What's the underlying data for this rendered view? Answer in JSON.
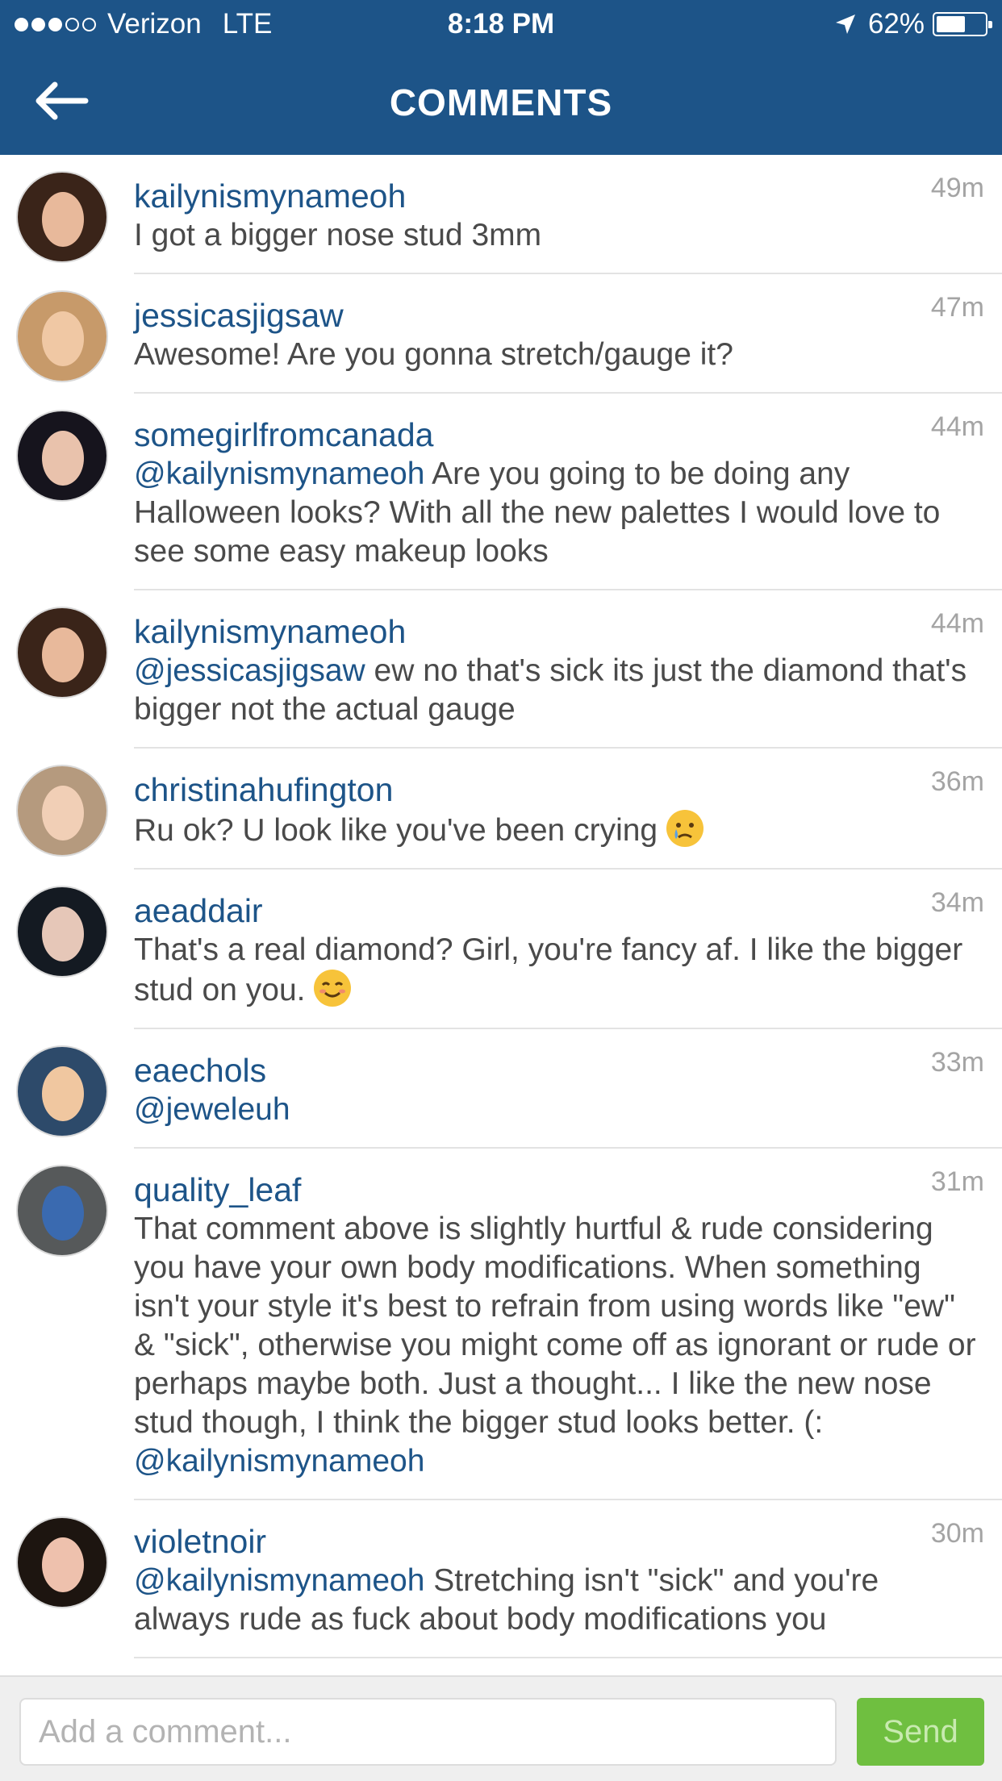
{
  "status_bar": {
    "carrier": "Verizon",
    "network": "LTE",
    "time": "8:18 PM",
    "battery_percent": "62%",
    "battery_level": 0.62,
    "signal_bars_filled": 3,
    "signal_bars_total": 5
  },
  "nav": {
    "title": "COMMENTS",
    "back_icon": "arrow-left-icon"
  },
  "colors": {
    "brand": "#1d5488",
    "username": "#1d5488",
    "text": "#4a4a4a",
    "timestamp": "#a4a4a4",
    "send_button": "#6fbf40"
  },
  "comments": [
    {
      "user": "kailynismyname",
      "user_suffix": "oh",
      "parts": [
        {
          "type": "text",
          "value": "I got a bigger nose stud 3mm"
        }
      ],
      "time": "49m"
    },
    {
      "user": "jessicasjigsaw",
      "parts": [
        {
          "type": "text",
          "value": "Awesome! Are you gonna stretch/gauge it?"
        }
      ],
      "time": "47m"
    },
    {
      "user": "somegirlfromcanada",
      "parts": [
        {
          "type": "mention",
          "value": "@kailynismynameoh"
        },
        {
          "type": "text",
          "value": " Are you going to be doing any Halloween looks? With all the new palettes I would love to see some easy makeup looks"
        }
      ],
      "time": "44m"
    },
    {
      "user": "kailynismynameoh",
      "parts": [
        {
          "type": "mention",
          "value": "@jessicasjigsaw"
        },
        {
          "type": "text",
          "value": " ew no that's sick its just the diamond that's bigger not the actual gauge"
        }
      ],
      "time": "44m"
    },
    {
      "user": "christinahufington",
      "parts": [
        {
          "type": "text",
          "value": "Ru ok? U look like you've been crying "
        },
        {
          "type": "emoji",
          "value": "crying-face"
        }
      ],
      "time": "36m"
    },
    {
      "user": "aeaddair",
      "parts": [
        {
          "type": "text",
          "value": "That's a real diamond? Girl, you're fancy af. I like the bigger stud on you. "
        },
        {
          "type": "emoji",
          "value": "smiling-face"
        }
      ],
      "time": "34m"
    },
    {
      "user": "eaechols",
      "parts": [
        {
          "type": "mention",
          "value": "@jeweleuh"
        }
      ],
      "time": "33m"
    },
    {
      "user": "quality_leaf",
      "parts": [
        {
          "type": "text",
          "value": "That comment above is slightly hurtful & rude considering you have your own body modifications. When something isn't your style it's best to refrain from using words like \"ew\" & \"sick\", otherwise you might come off as ignorant or rude or perhaps maybe both. Just a thought... I like the new nose stud though, I think the bigger stud looks better. (: "
        },
        {
          "type": "mention",
          "value": "@kailynismynameoh"
        }
      ],
      "time": "31m"
    },
    {
      "user": "violetnoir",
      "parts": [
        {
          "type": "mention",
          "value": "@kailynismynameoh"
        },
        {
          "type": "text",
          "value": " Stretching isn't \"sick\" and you're always rude as fuck about body modifications you"
        }
      ],
      "time": "30m"
    }
  ],
  "input": {
    "placeholder": "Add a comment...",
    "value": "",
    "send_label": "Send"
  }
}
